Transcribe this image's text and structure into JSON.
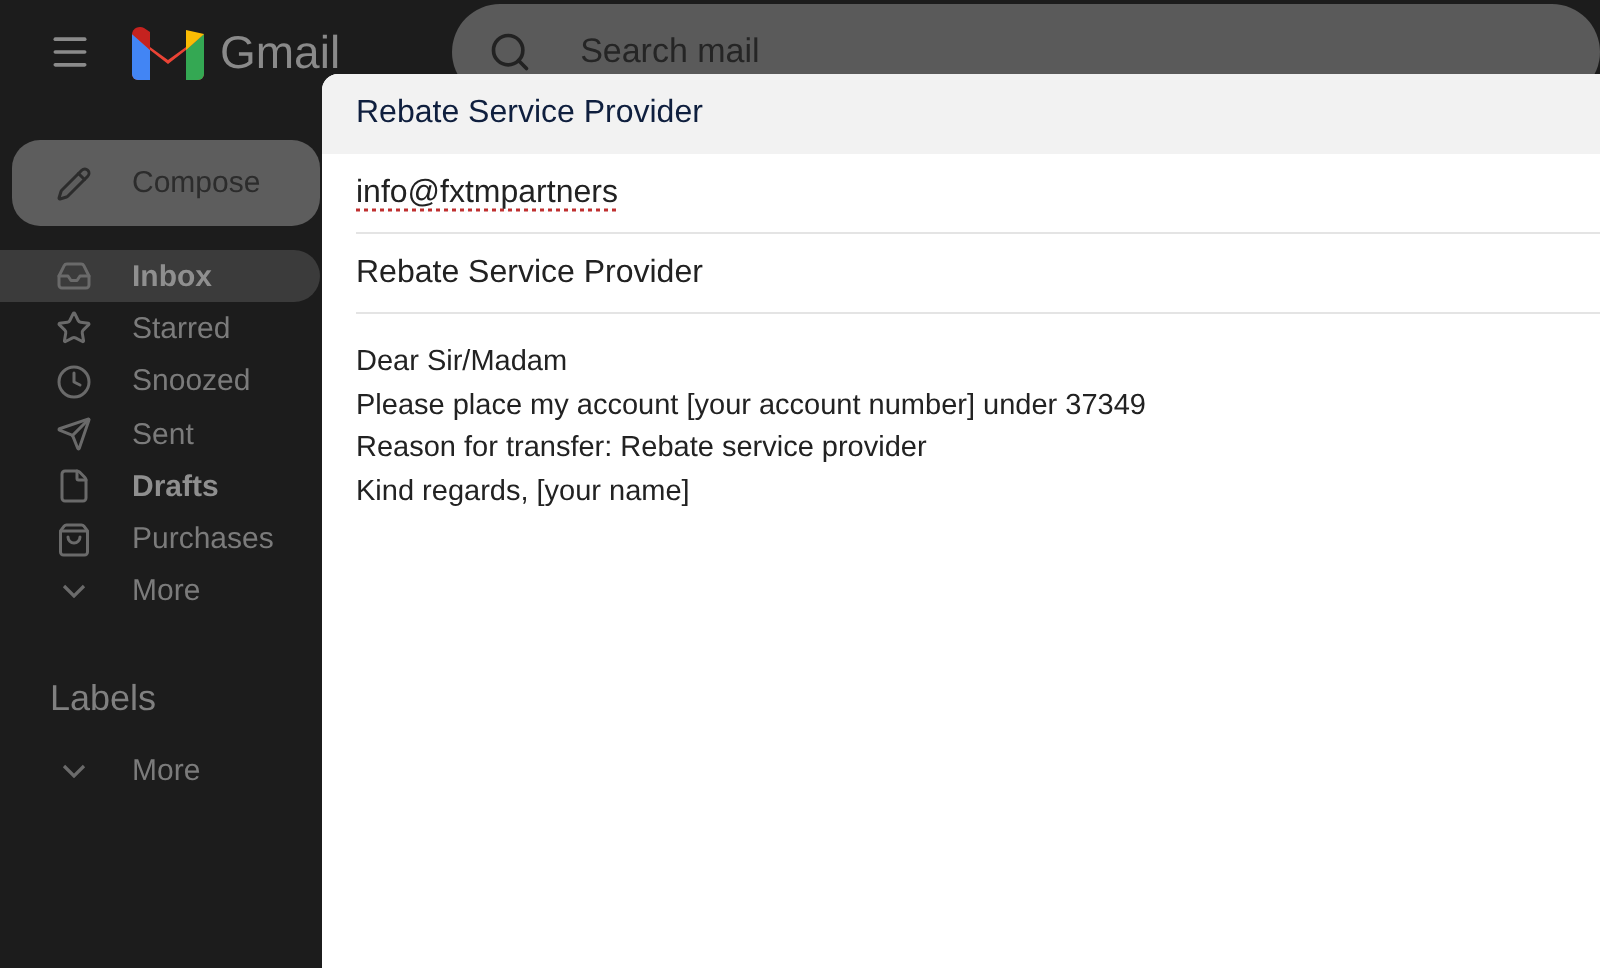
{
  "app": {
    "name": "Gmail"
  },
  "search": {
    "placeholder": "Search mail"
  },
  "compose_button": "Compose",
  "nav": [
    {
      "label": "Inbox",
      "selected": true,
      "bold": true
    },
    {
      "label": "Starred",
      "selected": false,
      "bold": false
    },
    {
      "label": "Snoozed",
      "selected": false,
      "bold": false
    },
    {
      "label": "Sent",
      "selected": false,
      "bold": false
    },
    {
      "label": "Drafts",
      "selected": false,
      "bold": true
    },
    {
      "label": "Purchases",
      "selected": false,
      "bold": false
    },
    {
      "label": "More",
      "selected": false,
      "bold": false
    }
  ],
  "labels": {
    "heading": "Labels",
    "more": "More"
  },
  "compose": {
    "title": "Rebate Service Provider",
    "to": "info@fxtmpartners",
    "subject": "Rebate Service Provider",
    "body": [
      "Dear Sir/Madam",
      "Please place my account [your account number] under 37349",
      "Reason for transfer: Rebate service provider",
      "Kind regards, [your name]"
    ]
  }
}
